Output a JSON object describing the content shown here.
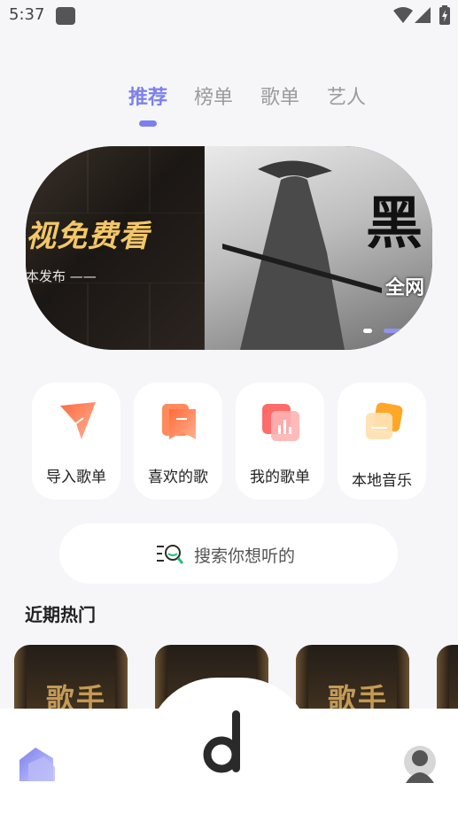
{
  "status_bar": {
    "time": "5:37"
  },
  "tabs": [
    {
      "label": "推荐",
      "active": true
    },
    {
      "label": "榜单",
      "active": false
    },
    {
      "label": "歌单",
      "active": false
    },
    {
      "label": "艺人",
      "active": false
    }
  ],
  "banner": {
    "left_title": "视免费看",
    "left_sub": "本发布 ——",
    "right_title": "黑",
    "right_sub": "全网"
  },
  "quick_actions": [
    {
      "label": "导入歌单",
      "icon": "import-playlist-icon"
    },
    {
      "label": "喜欢的歌",
      "icon": "liked-songs-icon"
    },
    {
      "label": "我的歌单",
      "icon": "my-playlist-icon"
    },
    {
      "label": "本地音乐",
      "icon": "local-music-icon"
    }
  ],
  "search": {
    "placeholder": "搜索你想听的"
  },
  "section": {
    "title": "近期热门"
  },
  "hot_cards": [
    {
      "text": "歌手"
    },
    {
      "text": "歌手"
    },
    {
      "text": "歌手"
    }
  ],
  "colors": {
    "accent": "#7c80ee",
    "background": "#f6f6f8"
  }
}
